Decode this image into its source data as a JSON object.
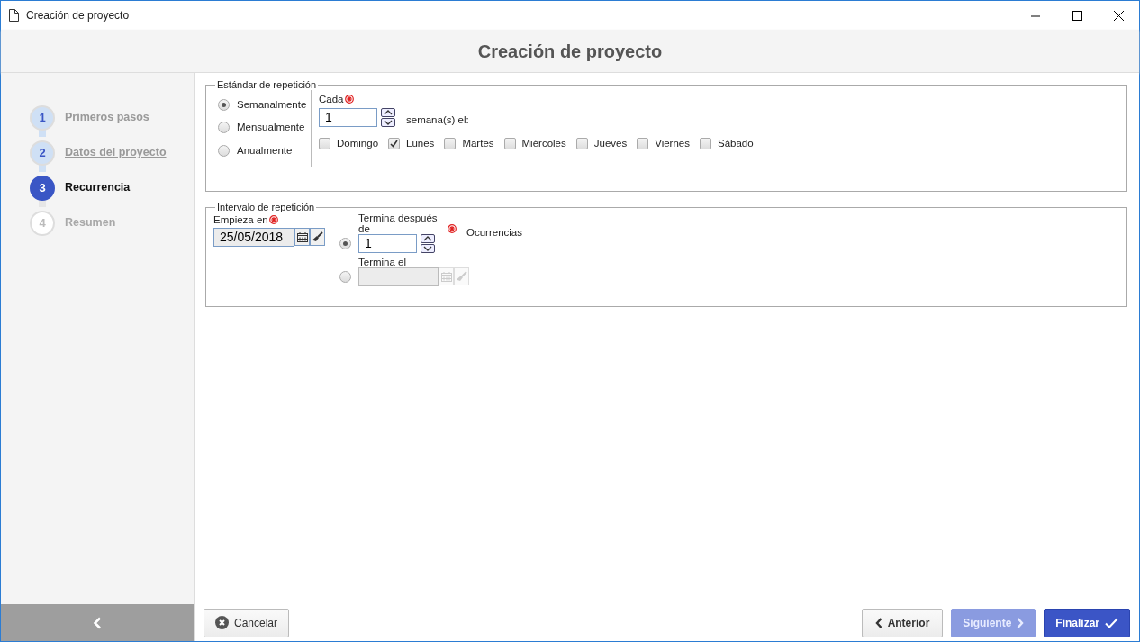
{
  "window": {
    "title": "Creación de proyecto"
  },
  "header": {
    "title": "Creación de proyecto"
  },
  "steps": [
    {
      "number": "1",
      "label": "Primeros pasos",
      "completed": true,
      "selected": false
    },
    {
      "number": "2",
      "label": "Datos del proyecto",
      "completed": true,
      "selected": false
    },
    {
      "number": "3",
      "label": "Recurrencia",
      "completed": false,
      "selected": true
    },
    {
      "number": "4",
      "label": "Resumen",
      "completed": false,
      "selected": false
    }
  ],
  "pattern": {
    "legend": "Estándar de repetición",
    "options": [
      {
        "label": "Semanalmente",
        "selected": true
      },
      {
        "label": "Mensualmente",
        "selected": false
      },
      {
        "label": "Anualmente",
        "selected": false
      }
    ],
    "every_label": "Cada",
    "every_value": "1",
    "unit": "semana(s) el:",
    "days": [
      {
        "label": "Domingo",
        "checked": false
      },
      {
        "label": "Lunes",
        "checked": true
      },
      {
        "label": "Martes",
        "checked": false
      },
      {
        "label": "Miércoles",
        "checked": false
      },
      {
        "label": "Jueves",
        "checked": false
      },
      {
        "label": "Viernes",
        "checked": false
      },
      {
        "label": "Sábado",
        "checked": false
      }
    ]
  },
  "interval": {
    "legend": "Intervalo de repetición",
    "start_label": "Empieza en",
    "start_value": "25/05/2018",
    "end_options": [
      {
        "kind": "count",
        "label": "Termina después de",
        "value": "1",
        "suffix": "Ocurrencias",
        "selected": true,
        "disabled": false
      },
      {
        "kind": "date",
        "label": "Termina el",
        "selected": false,
        "disabled": true
      }
    ]
  },
  "buttons": [
    {
      "kind": "cancel",
      "label": "Cancelar",
      "disabled": false
    },
    {
      "kind": "back",
      "label": "Anterior",
      "disabled": false
    },
    {
      "kind": "next",
      "label": "Siguiente",
      "disabled": true
    },
    {
      "kind": "finish",
      "label": "Finalizar",
      "disabled": false
    }
  ]
}
